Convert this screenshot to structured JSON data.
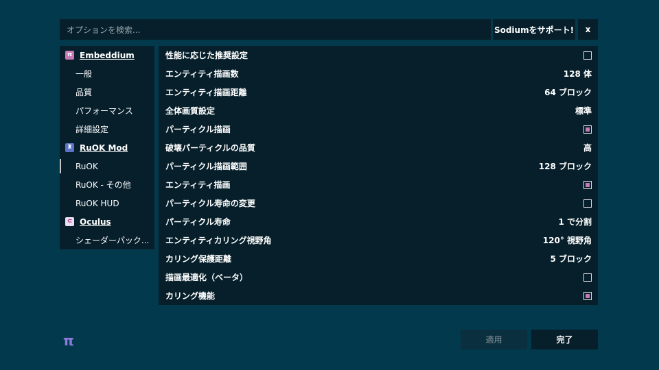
{
  "search": {
    "placeholder": "オプションを検索..."
  },
  "header": {
    "support_label": "Sodiumをサポート!",
    "close_label": "x"
  },
  "sidebar": {
    "items": [
      {
        "type": "mod",
        "label": "Embeddium",
        "icon": "embeddium-pi-icon",
        "icon_text": "π",
        "icon_color": "#c779b5"
      },
      {
        "type": "page",
        "label": "一般"
      },
      {
        "type": "page",
        "label": "品質"
      },
      {
        "type": "page",
        "label": "パフォーマンス"
      },
      {
        "type": "page",
        "label": "詳細設定"
      },
      {
        "type": "mod",
        "label": "RuOK Mod",
        "icon": "ruok-mod-icon",
        "icon_text": "♜",
        "icon_color": "#5b74c9"
      },
      {
        "type": "page",
        "label": "RuOK",
        "active": true
      },
      {
        "type": "page",
        "label": "RuOK - その他"
      },
      {
        "type": "page",
        "label": "RuOK HUD"
      },
      {
        "type": "mod",
        "label": "Oculus",
        "icon": "oculus-icon",
        "icon_text": "⊂",
        "icon_color": "#e9e1f1"
      },
      {
        "type": "page",
        "label": "シェーダーパック..."
      }
    ]
  },
  "options": [
    {
      "label": "性能に応じた推奨設定",
      "kind": "checkbox",
      "checked": false
    },
    {
      "label": "エンティティ描画数",
      "kind": "value",
      "value": "128 体"
    },
    {
      "label": "エンティティ描画距離",
      "kind": "value",
      "value": "64 ブロック"
    },
    {
      "label": "全体画質設定",
      "kind": "value",
      "value": "標準"
    },
    {
      "label": "パーティクル描画",
      "kind": "checkbox",
      "checked": true
    },
    {
      "label": "破壊パーティクルの品質",
      "kind": "value",
      "value": "高"
    },
    {
      "label": "パーティクル描画範囲",
      "kind": "value",
      "value": "128 ブロック"
    },
    {
      "label": "エンティティ描画",
      "kind": "checkbox",
      "checked": true
    },
    {
      "label": "パーティクル寿命の変更",
      "kind": "checkbox",
      "checked": false
    },
    {
      "label": "パーティクル寿命",
      "kind": "value",
      "value": "1 で分割"
    },
    {
      "label": "エンティティカリング視野角",
      "kind": "value",
      "value": "120° 視野角"
    },
    {
      "label": "カリング保護距離",
      "kind": "value",
      "value": "5 ブロック"
    },
    {
      "label": "描画最適化（ベータ）",
      "kind": "checkbox",
      "checked": false
    },
    {
      "label": "カリング機能",
      "kind": "checkbox",
      "checked": true
    }
  ],
  "footer": {
    "logo": "π",
    "apply_label": "適用",
    "done_label": "完了"
  },
  "colors": {
    "background": "#03394d",
    "panel": "#061f2b",
    "accent": "#c779b5",
    "logo": "#8b7ad9"
  }
}
